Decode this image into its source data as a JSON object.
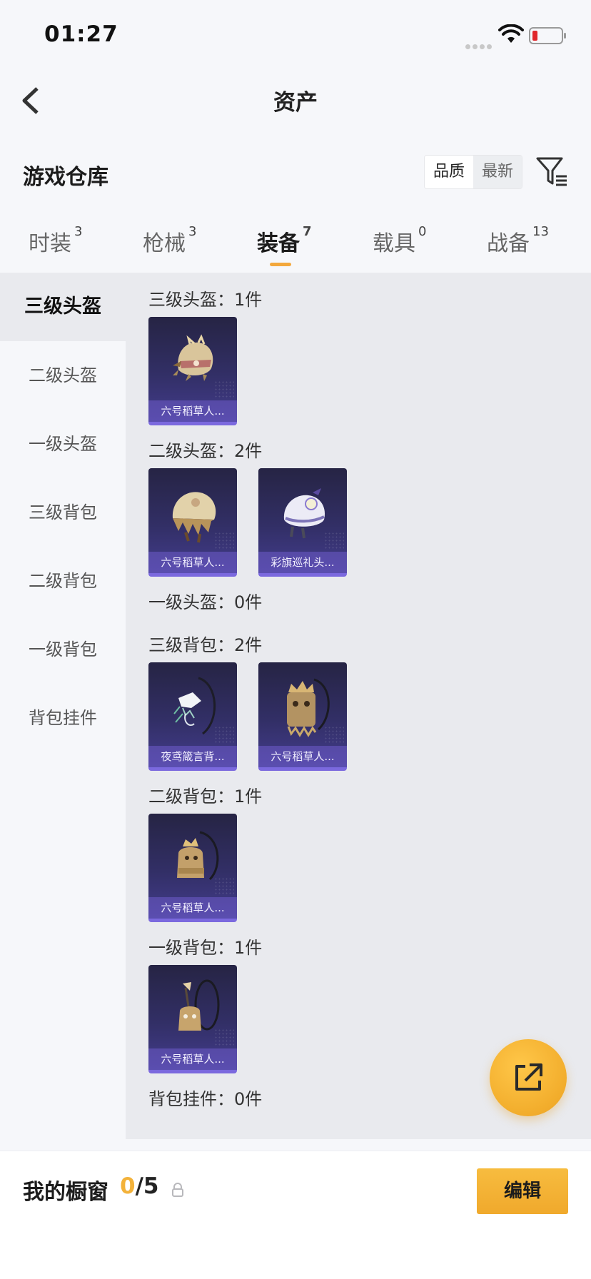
{
  "status": {
    "time": "01:27"
  },
  "nav": {
    "title": "资产"
  },
  "section": {
    "title": "游戏仓库"
  },
  "sort": {
    "quality": "品质",
    "newest": "最新"
  },
  "tabs": [
    {
      "label": "时装",
      "count": "3"
    },
    {
      "label": "枪械",
      "count": "3"
    },
    {
      "label": "装备",
      "count": "7"
    },
    {
      "label": "载具",
      "count": "0"
    },
    {
      "label": "战备",
      "count": "13"
    }
  ],
  "active_tab": "装备",
  "sidebar": {
    "items": [
      {
        "label": "三级头盔"
      },
      {
        "label": "二级头盔"
      },
      {
        "label": "一级头盔"
      },
      {
        "label": "三级背包"
      },
      {
        "label": "二级背包"
      },
      {
        "label": "一级背包"
      },
      {
        "label": "背包挂件"
      }
    ]
  },
  "groups": [
    {
      "title": "三级头盔：1件",
      "items": [
        {
          "name": "六号稻草人...",
          "icon": "scarecrow-helmet-icon"
        }
      ]
    },
    {
      "title": "二级头盔：2件",
      "items": [
        {
          "name": "六号稻草人...",
          "icon": "scarecrow-helmet-icon"
        },
        {
          "name": "彩旗巡礼头...",
          "icon": "festival-helmet-icon"
        }
      ]
    },
    {
      "title": "一级头盔：0件",
      "items": []
    },
    {
      "title": "三级背包：2件",
      "items": [
        {
          "name": "夜鸢箴言背...",
          "icon": "night-kite-backpack-icon"
        },
        {
          "name": "六号稻草人...",
          "icon": "scarecrow-backpack-icon"
        }
      ]
    },
    {
      "title": "二级背包：1件",
      "items": [
        {
          "name": "六号稻草人...",
          "icon": "scarecrow-backpack-icon"
        }
      ]
    },
    {
      "title": "一级背包：1件",
      "items": [
        {
          "name": "六号稻草人...",
          "icon": "scarecrow-backpack-icon"
        }
      ]
    },
    {
      "title": "背包挂件：0件",
      "items": []
    }
  ],
  "showcase": {
    "label": "我的橱窗",
    "current": "0",
    "total": "/5",
    "edit_label": "编辑"
  },
  "colors": {
    "accent": "#f3a83c",
    "card_top": "#262444",
    "card_bottom": "#433c8c",
    "card_border": "#7b69de"
  }
}
